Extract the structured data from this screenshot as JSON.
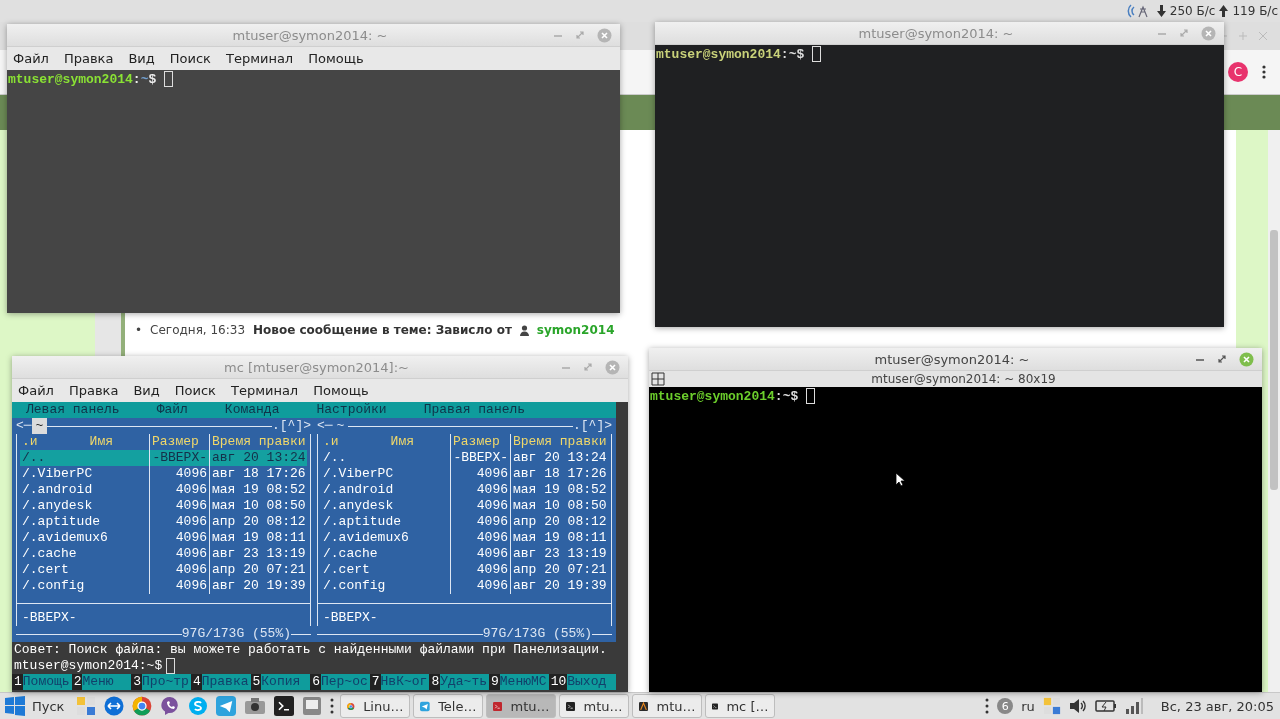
{
  "top_panel": {
    "download_speed": "250 Б/с",
    "upload_speed": "119 Б/с"
  },
  "browser": {
    "avatar_letter": "С",
    "message": {
      "bullet": "•",
      "time": "Сегодня, 16:33",
      "text": "Новое сообщение в теме: Зависло от",
      "author": "symon2014"
    }
  },
  "terminal_top_left": {
    "title": "mtuser@symon2014: ~",
    "active": false,
    "menu": [
      "Файл",
      "Правка",
      "Вид",
      "Поиск",
      "Терминал",
      "Помощь"
    ],
    "prompt": {
      "user_host": "mtuser@symon2014",
      "separator": ":",
      "path": "~",
      "sign": "$"
    }
  },
  "terminal_top_right": {
    "title": "mtuser@symon2014: ~",
    "active": false,
    "prompt": {
      "user_host": "mtuser@symon2014",
      "separator": ":",
      "path": "~",
      "sign": "$"
    }
  },
  "mc_window": {
    "title": "mc [mtuser@symon2014]:~",
    "active": false,
    "menu": [
      "Файл",
      "Правка",
      "Вид",
      "Поиск",
      "Терминал",
      "Помощь"
    ],
    "mc_menu": [
      "Левая панель",
      "Файл",
      "Команда",
      "Настройки",
      "Правая панель"
    ],
    "panels": [
      {
        "active": true,
        "nav_left": "<─",
        "path": "~",
        "nav_right": ".[^]>",
        "columns": [
          ".и",
          "Имя",
          "Размер",
          "Время правки"
        ],
        "rows": [
          {
            "name": "/..",
            "size": "-ВВЕРХ-",
            "time": "авг 20 13:24",
            "selected": true
          },
          {
            "name": "/.ViberPC",
            "size": "4096",
            "time": "авг 18 17:26",
            "selected": false
          },
          {
            "name": "/.android",
            "size": "4096",
            "time": "мая 19 08:52",
            "selected": false
          },
          {
            "name": "/.anydesk",
            "size": "4096",
            "time": "мая 10 08:50",
            "selected": false
          },
          {
            "name": "/.aptitude",
            "size": "4096",
            "time": "апр 20 08:12",
            "selected": false
          },
          {
            "name": "/.avidemux6",
            "size": "4096",
            "time": "мая 19 08:11",
            "selected": false
          },
          {
            "name": "/.cache",
            "size": "4096",
            "time": "авг 23 13:19",
            "selected": false
          },
          {
            "name": "/.cert",
            "size": "4096",
            "time": "апр 20 07:21",
            "selected": false
          },
          {
            "name": "/.config",
            "size": "4096",
            "time": "авг 20 19:39",
            "selected": false
          }
        ],
        "status": "-ВВЕРХ-",
        "disk": "97G/173G (55%)"
      },
      {
        "active": false,
        "nav_left": "<─",
        "path": "~",
        "nav_right": ".[^]>",
        "columns": [
          ".и",
          "Имя",
          "Размер",
          "Время правки"
        ],
        "rows": [
          {
            "name": "/..",
            "size": "-ВВЕРХ-",
            "time": "авг 20 13:24",
            "selected": false
          },
          {
            "name": "/.ViberPC",
            "size": "4096",
            "time": "авг 18 17:26",
            "selected": false
          },
          {
            "name": "/.android",
            "size": "4096",
            "time": "мая 19 08:52",
            "selected": false
          },
          {
            "name": "/.anydesk",
            "size": "4096",
            "time": "мая 10 08:50",
            "selected": false
          },
          {
            "name": "/.aptitude",
            "size": "4096",
            "time": "апр 20 08:12",
            "selected": false
          },
          {
            "name": "/.avidemux6",
            "size": "4096",
            "time": "мая 19 08:11",
            "selected": false
          },
          {
            "name": "/.cache",
            "size": "4096",
            "time": "авг 23 13:19",
            "selected": false
          },
          {
            "name": "/.cert",
            "size": "4096",
            "time": "апр 20 07:21",
            "selected": false
          },
          {
            "name": "/.config",
            "size": "4096",
            "time": "авг 20 19:39",
            "selected": false
          }
        ],
        "status": "-ВВЕРХ-",
        "disk": "97G/173G (55%)"
      }
    ],
    "hint": "Совет: Поиск файла: вы можете работать с найденными файлами при Панелизации.",
    "prompt": "mtuser@symon2014:~$",
    "function_keys": [
      {
        "num": "1",
        "label": "Помощь"
      },
      {
        "num": "2",
        "label": "Меню"
      },
      {
        "num": "3",
        "label": "Про~тр"
      },
      {
        "num": "4",
        "label": "Правка"
      },
      {
        "num": "5",
        "label": "Копия"
      },
      {
        "num": "6",
        "label": "Пер~ос"
      },
      {
        "num": "7",
        "label": "НвК~ог"
      },
      {
        "num": "8",
        "label": "Уда~ть"
      },
      {
        "num": "9",
        "label": "МенюМС"
      },
      {
        "num": "10",
        "label": "Выход"
      }
    ]
  },
  "terminal_bottom_right": {
    "title": "mtuser@symon2014: ~",
    "active": true,
    "subtitle": "mtuser@symon2014: ~ 80x19",
    "prompt": {
      "user_host": "mtuser@symon2014",
      "separator": ":",
      "path": "~",
      "sign": "$"
    }
  },
  "taskbar": {
    "start_label": "Пуск",
    "tasks": [
      {
        "kind": "browser",
        "label": "Linu…",
        "selected": false
      },
      {
        "kind": "messenger",
        "label": "Tele…",
        "selected": false
      },
      {
        "kind": "shell",
        "label": "mtu…",
        "selected": true
      },
      {
        "kind": "terminal",
        "label": "mtu…",
        "selected": false
      },
      {
        "kind": "editor",
        "label": "mtu…",
        "selected": false
      },
      {
        "kind": "terminal",
        "label": "mc […",
        "selected": false
      }
    ],
    "notification_count": "6",
    "keyboard_layout": "ru",
    "clock": "Вс, 23 авг, 20:05"
  }
}
